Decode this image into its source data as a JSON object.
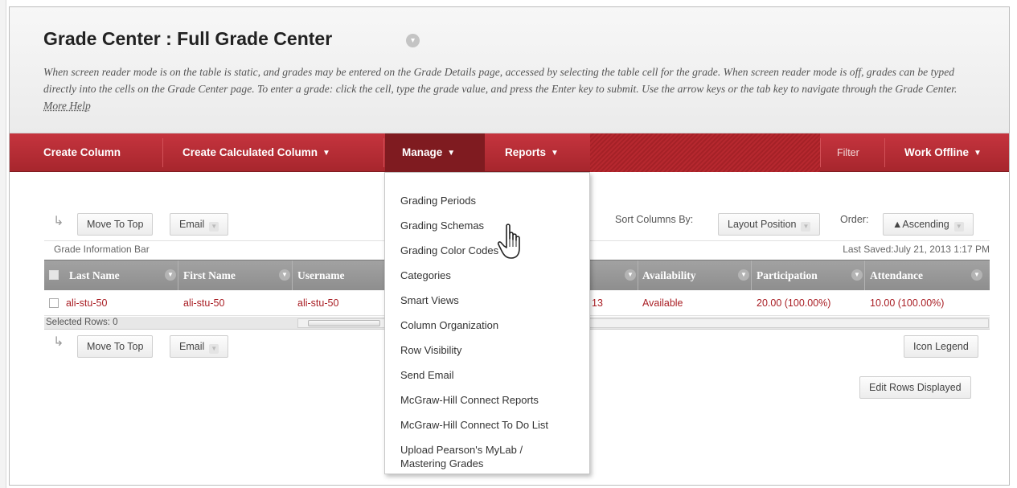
{
  "header": {
    "title": "Grade Center : Full Grade Center",
    "description": "When screen reader mode is on the table is static, and grades may be entered on the Grade Details page, accessed by selecting the table cell for the grade. When screen reader mode is off, grades can be typed directly into the cells on the Grade Center page. To enter a grade: click the cell, type the grade value, and press the Enter key to submit. Use the arrow keys or the tab key to navigate through the Grade Center.",
    "more_help": "More Help"
  },
  "navbar": {
    "create_column": "Create Column",
    "create_calculated_column": "Create Calculated Column",
    "manage": "Manage",
    "reports": "Reports",
    "filter": "Filter",
    "work_offline": "Work Offline",
    "chevron": "⌄"
  },
  "toolbar_top": {
    "move_to_top": "Move To Top",
    "email": "Email"
  },
  "toolbar_bottom": {
    "move_to_top": "Move To Top",
    "email": "Email",
    "icon_legend": "Icon Legend",
    "edit_rows_displayed": "Edit Rows Displayed"
  },
  "sort": {
    "label": "Sort Columns By:",
    "value": "Layout Position",
    "order_label": "Order:",
    "order_value": "▲Ascending"
  },
  "info_bar": {
    "label": "Grade Information Bar",
    "last_saved": "Last Saved:July 21, 2013 1:17 PM"
  },
  "grid": {
    "columns": [
      "Last Name",
      "First Name",
      "Username",
      "Availability",
      "Participation",
      "Attendance"
    ],
    "row": {
      "last_name": "ali-stu-50",
      "first_name": "ali-stu-50",
      "username": "ali-stu-50",
      "partial": "13",
      "availability": "Available",
      "participation": "20.00 (100.00%)",
      "attendance": "10.00 (100.00%)"
    },
    "selected_rows": "Selected Rows: 0"
  },
  "manage_menu": {
    "items": [
      "Grading Periods",
      "Grading Schemas",
      "Grading Color Codes",
      "Categories",
      "Smart Views",
      "Column Organization",
      "Row Visibility",
      "Send Email",
      "McGraw-Hill Connect Reports",
      "McGraw-Hill Connect To Do List",
      "Upload Pearson's MyLab /",
      "Mastering Grades"
    ]
  },
  "colors": {
    "nav_red": "#b02a31",
    "nav_active": "#7f1b20",
    "link_red": "#a91e24",
    "grid_header": "#989898"
  },
  "icons": [
    "chevron-down-icon",
    "tree-arrow-icon",
    "hand-cursor-icon",
    "checkbox-icon"
  ]
}
